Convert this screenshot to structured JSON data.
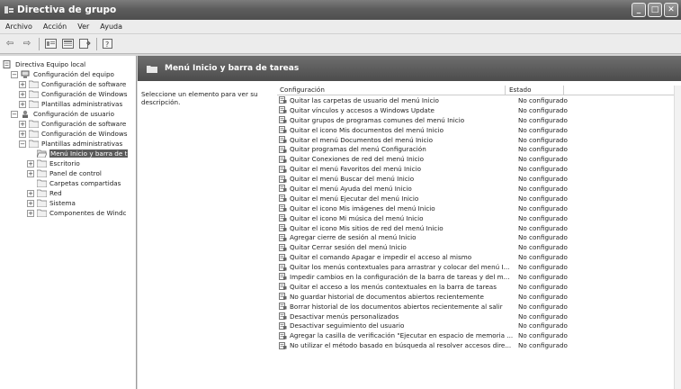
{
  "window": {
    "title": "Directiva de grupo"
  },
  "menu": [
    "Archivo",
    "Acción",
    "Ver",
    "Ayuda"
  ],
  "window_controls": {
    "minimize": "_",
    "maximize": "□",
    "close": "✕"
  },
  "toolbar": {
    "back": "⇦",
    "forward": "⇨",
    "icons": [
      "up-icon",
      "show-hide-tree-icon",
      "export-list-icon",
      "help-icon"
    ]
  },
  "tree": [
    {
      "label": "Directiva Equipo local",
      "indent": 0,
      "exp": "",
      "icon": "computer-policy-icon"
    },
    {
      "label": "Configuración del equipo",
      "indent": 1,
      "exp": "−",
      "icon": "computer-icon"
    },
    {
      "label": "Configuración de software",
      "indent": 2,
      "exp": "+",
      "icon": "folder-icon"
    },
    {
      "label": "Configuración de Windows",
      "indent": 2,
      "exp": "+",
      "icon": "folder-icon"
    },
    {
      "label": "Plantillas administrativas",
      "indent": 2,
      "exp": "+",
      "icon": "folder-icon"
    },
    {
      "label": "Configuración de usuario",
      "indent": 1,
      "exp": "−",
      "icon": "user-icon"
    },
    {
      "label": "Configuración de software",
      "indent": 2,
      "exp": "+",
      "icon": "folder-icon"
    },
    {
      "label": "Configuración de Windows",
      "indent": 2,
      "exp": "+",
      "icon": "folder-icon"
    },
    {
      "label": "Plantillas administrativas",
      "indent": 2,
      "exp": "−",
      "icon": "folder-icon"
    },
    {
      "label": "Menú Inicio y barra de t",
      "indent": 3,
      "exp": "",
      "icon": "folder-open-icon",
      "selected": true
    },
    {
      "label": "Escritorio",
      "indent": 3,
      "exp": "+",
      "icon": "folder-icon"
    },
    {
      "label": "Panel de control",
      "indent": 3,
      "exp": "+",
      "icon": "folder-icon"
    },
    {
      "label": "Carpetas compartidas",
      "indent": 3,
      "exp": "",
      "icon": "folder-icon"
    },
    {
      "label": "Red",
      "indent": 3,
      "exp": "+",
      "icon": "folder-icon"
    },
    {
      "label": "Sistema",
      "indent": 3,
      "exp": "+",
      "icon": "folder-icon"
    },
    {
      "label": "Componentes de Windc",
      "indent": 3,
      "exp": "+",
      "icon": "folder-icon"
    }
  ],
  "pane": {
    "title": "Menú Inicio y barra de tareas",
    "description": "Seleccione un elemento para ver su descripción.",
    "columns": {
      "config": "Configuración",
      "state": "Estado"
    }
  },
  "settings": [
    {
      "name": "Quitar las carpetas de usuario del menú Inicio",
      "state": "No configurado"
    },
    {
      "name": "Quitar vínculos y accesos a Windows Update",
      "state": "No configurado"
    },
    {
      "name": "Quitar grupos de programas comunes del menú Inicio",
      "state": "No configurado"
    },
    {
      "name": "Quitar el icono Mis documentos del menú Inicio",
      "state": "No configurado"
    },
    {
      "name": "Quitar el menú Documentos del menú Inicio",
      "state": "No configurado"
    },
    {
      "name": "Quitar programas del menú Configuración",
      "state": "No configurado"
    },
    {
      "name": "Quitar Conexiones de red del menú Inicio",
      "state": "No configurado"
    },
    {
      "name": "Quitar el menú Favoritos del menú Inicio",
      "state": "No configurado"
    },
    {
      "name": "Quitar el menú Buscar del menú Inicio",
      "state": "No configurado"
    },
    {
      "name": "Quitar el menú Ayuda del menú Inicio",
      "state": "No configurado"
    },
    {
      "name": "Quitar el menú Ejecutar del menú Inicio",
      "state": "No configurado"
    },
    {
      "name": "Quitar el icono Mis imágenes del menú Inicio",
      "state": "No configurado"
    },
    {
      "name": "Quitar el icono Mi música del menú Inicio",
      "state": "No configurado"
    },
    {
      "name": "Quitar el icono Mis sitios de red del menú Inicio",
      "state": "No configurado"
    },
    {
      "name": "Agregar cierre de sesión al menú Inicio",
      "state": "No configurado"
    },
    {
      "name": "Quitar Cerrar sesión del menú Inicio",
      "state": "No configurado"
    },
    {
      "name": "Quitar el comando Apagar e impedir el acceso al mismo",
      "state": "No configurado"
    },
    {
      "name": "Quitar los menús contextuales para arrastrar y colocar del menú I...",
      "state": "No configurado"
    },
    {
      "name": "Impedir cambios en la configuración de la barra de tareas y del m...",
      "state": "No configurado"
    },
    {
      "name": "Quitar el acceso a los menús contextuales en la barra de tareas",
      "state": "No configurado"
    },
    {
      "name": "No guardar historial de documentos abiertos recientemente",
      "state": "No configurado"
    },
    {
      "name": "Borrar historial de los documentos abiertos recientemente al salir",
      "state": "No configurado"
    },
    {
      "name": "Desactivar menús personalizados",
      "state": "No configurado"
    },
    {
      "name": "Desactivar seguimiento del usuario",
      "state": "No configurado"
    },
    {
      "name": "Agregar la casilla de verificación \"Ejecutar en espacio de memoria ...",
      "state": "No configurado"
    },
    {
      "name": "No utilizar el método basado en búsqueda al resolver accesos dire...",
      "state": "No configurado"
    }
  ]
}
